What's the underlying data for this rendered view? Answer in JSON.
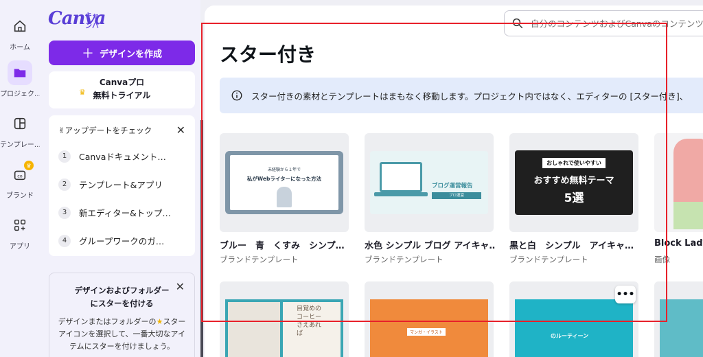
{
  "rail": {
    "items": [
      {
        "label": "ホーム"
      },
      {
        "label": "プロジェク…"
      },
      {
        "label": "テンプレー…"
      },
      {
        "label": "ブランド"
      },
      {
        "label": "アプリ"
      }
    ]
  },
  "logo": {
    "word": "Canva",
    "kana": "キャンバ"
  },
  "panel": {
    "create_label": "デザインを作成",
    "pro_line1": "Canvaプロ",
    "pro_line2": "無料トライアル",
    "updates": {
      "heading": "アップデートをチェック",
      "items": [
        {
          "num": "1",
          "label": "Canvaドキュメント…"
        },
        {
          "num": "2",
          "label": "テンプレート&アプリ"
        },
        {
          "num": "3",
          "label": "新エディター&トップ…"
        },
        {
          "num": "4",
          "label": "グループワークのガ…"
        }
      ]
    },
    "star_card": {
      "title1": "デザインおよびフォルダー",
      "title2": "にスターを付ける",
      "body1": "デザインまたはフォルダーの",
      "body1b": "スター",
      "body2": "アイコンを選択して、一番大切なアイ",
      "body3": "テムにスターを付けましょう。"
    }
  },
  "search": {
    "placeholder": "自分のコンテンツおよびCanvaのコンテンツを"
  },
  "main": {
    "title": "スター付き",
    "banner": "スター付きの素材とテンプレートはまもなく移動します。プロジェクト内ではなく、エディターの [スター付き]、",
    "cards": [
      {
        "title": "ブルー　青　くすみ　シンプ…",
        "type": "ブランドテンプレート",
        "thumb_text1": "未経験から１年で",
        "thumb_text2": "私がWebライターになった方法"
      },
      {
        "title": "水色 シンプル ブログ アイキャ…",
        "type": "ブランドテンプレート",
        "thumb_text1": "ブログ運営報告",
        "thumb_text2": "ブロ運営"
      },
      {
        "title": "黒と白　シンプル　アイキャ…",
        "type": "ブランドテンプレート",
        "thumb_text1": "おしゃれで使いやすい",
        "thumb_text2": "おすすめ無料テーマ",
        "thumb_text3": "5選"
      },
      {
        "title": "Block Lady",
        "type": "画像"
      }
    ],
    "row2": [
      {
        "thumb_text": "目覚めのコーヒーさえあれば"
      },
      {
        "thumb_text": "マンガ・イラスト"
      },
      {
        "thumb_text": "のルーティーン",
        "more": "•••"
      },
      {}
    ]
  },
  "colors": {
    "accent": "#7d2ae8",
    "overlay": "#e8202a",
    "banner": "#e3ebfb"
  }
}
